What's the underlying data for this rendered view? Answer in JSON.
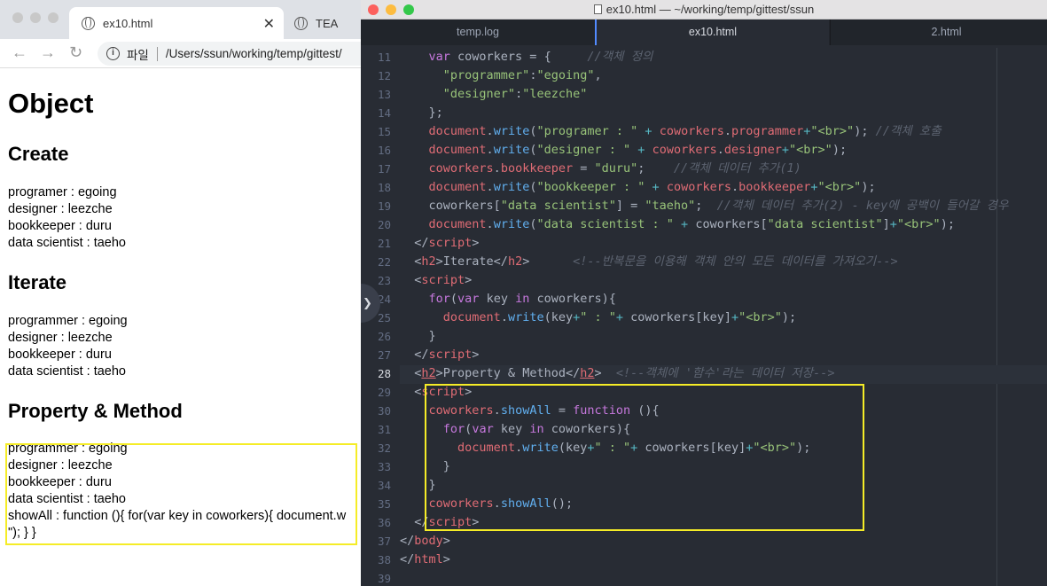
{
  "browser": {
    "tabs": [
      {
        "label": "ex10.html"
      },
      {
        "label": "TEA"
      }
    ],
    "address": {
      "scheme_label": "파일",
      "url": "/Users/ssun/working/temp/gittest/"
    },
    "page": {
      "title": "Object",
      "sections": [
        {
          "heading": "Create",
          "lines": [
            "programer : egoing",
            "designer : leezche",
            "bookkeeper : duru",
            "data scientist : taeho"
          ]
        },
        {
          "heading": "Iterate",
          "lines": [
            "programmer : egoing",
            "designer : leezche",
            "bookkeeper : duru",
            "data scientist : taeho"
          ]
        },
        {
          "heading": "Property & Method",
          "lines": [
            "programmer : egoing",
            "designer : leezche",
            "bookkeeper : duru",
            "data scientist : taeho",
            "showAll : function (){ for(var key in coworkers){ document.w",
            "\"); } }"
          ]
        }
      ]
    }
  },
  "editor": {
    "window_title": "ex10.html — ~/working/temp/gittest/ssun",
    "tabs": [
      {
        "label": "temp.log"
      },
      {
        "label": "ex10.html"
      },
      {
        "label": "2.html"
      }
    ],
    "line_numbers": [
      "11",
      "12",
      "13",
      "14",
      "15",
      "16",
      "17",
      "18",
      "19",
      "20",
      "21",
      "22",
      "23",
      "24",
      "25",
      "26",
      "27",
      "28",
      "29",
      "30",
      "31",
      "32",
      "33",
      "34",
      "35",
      "36",
      "37",
      "38",
      "39"
    ],
    "comments": {
      "l11": "//객체 정의",
      "l15": "//객체 호출",
      "l17": "//객체 데이터 추가(1)",
      "l19": "//객체 데이터 추가(2) - key에 공백이 들어갈 경우",
      "l22": "<!--반복문을 이용해 객체 안의 모든 데이터를 가져오기-->",
      "l28": "<!--객체에 '함수'라는 데이터 저장-->"
    }
  }
}
